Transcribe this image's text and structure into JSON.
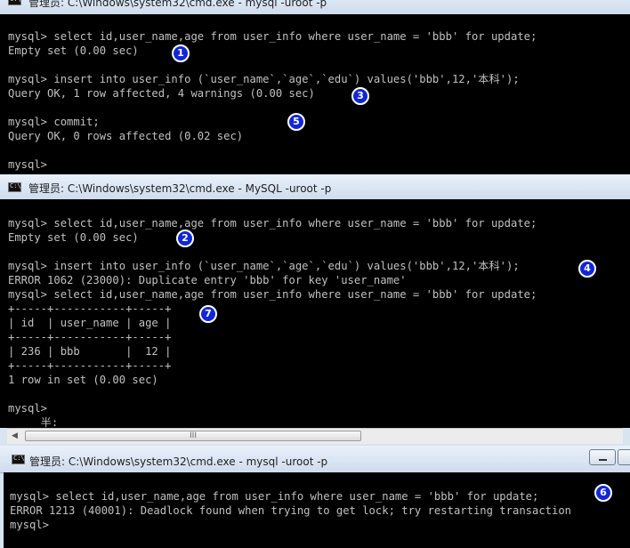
{
  "windows": {
    "top": {
      "title": "管理员: C:\\Windows\\system32\\cmd.exe - mysql  -uroot -p",
      "lines": [
        "mysql> select id,user_name,age from user_info where user_name = 'bbb' for update;",
        "Empty set (0.00 sec)",
        "",
        "mysql> insert into user_info (`user_name`,`age`,`edu`) values('bbb',12,'本科');",
        "Query OK, 1 row affected, 4 warnings (0.00 sec)",
        "",
        "mysql> commit;",
        "Query OK, 0 rows affected (0.02 sec)",
        "",
        "mysql>"
      ],
      "badges": [
        "1",
        "3",
        "5"
      ]
    },
    "middle": {
      "title": "管理员: C:\\Windows\\system32\\cmd.exe - MySQL  -uroot -p",
      "lines": [
        "mysql> select id,user_name,age from user_info where user_name = 'bbb' for update;",
        "Empty set (0.00 sec)",
        "",
        "mysql> insert into user_info (`user_name`,`age`,`edu`) values('bbb',12,'本科');",
        "ERROR 1062 (23000): Duplicate entry 'bbb' for key 'user_name'",
        "mysql> select id,user_name,age from user_info where user_name = 'bbb' for update;",
        "+-----+-----------+-----+",
        "| id  | user_name | age |",
        "+-----+-----------+-----+",
        "| 236 | bbb       |  12 |",
        "+-----+-----------+-----+",
        "1 row in set (0.00 sec)",
        "",
        "mysql>",
        "     半:"
      ],
      "badges": [
        "2",
        "4",
        "7"
      ],
      "scrollbar": {
        "left_arrow": "◀",
        "thumb_grip": "III"
      }
    },
    "bottom": {
      "title": "管理员: C:\\Windows\\system32\\cmd.exe - mysql  -uroot -p",
      "lines": [
        "mysql> select id,user_name,age from user_info where user_name = 'bbb' for update;",
        "ERROR 1213 (40001): Deadlock found when trying to get lock; try restarting transaction",
        "mysql>"
      ],
      "badges": [
        "6"
      ]
    }
  },
  "icons": {
    "window_icon": "console-icon",
    "minimize": "minimize-icon"
  },
  "colors": {
    "console_bg": "#000000",
    "console_text": "#c0c0c0",
    "badge": "#1226d8",
    "titlebar": "#dbe6f3"
  }
}
